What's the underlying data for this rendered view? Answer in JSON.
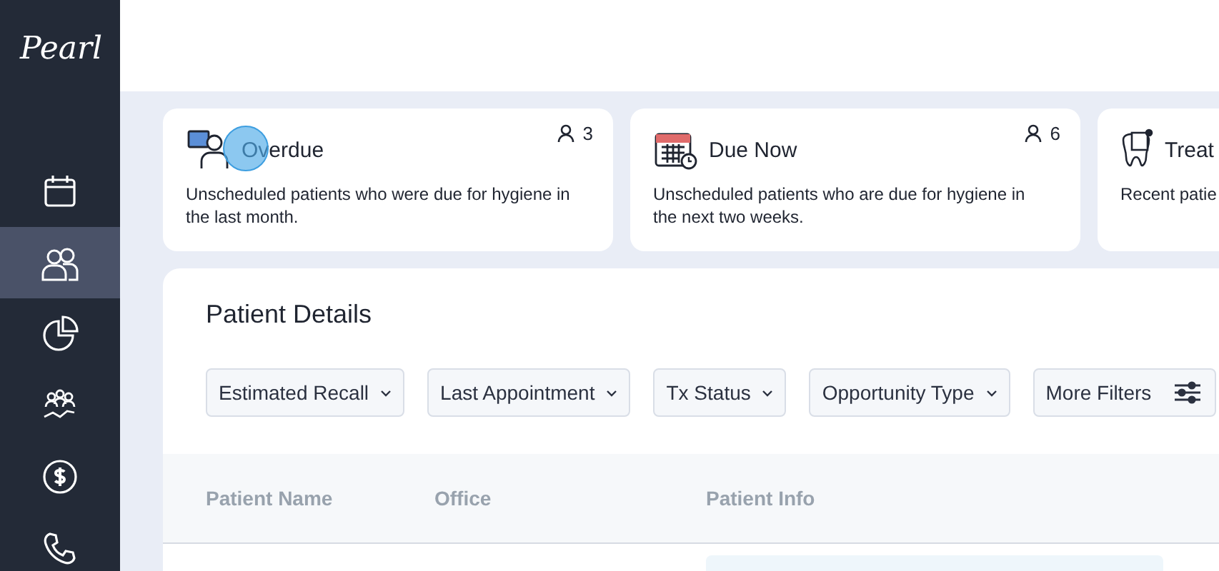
{
  "sidebar": {
    "logo": "Pearl",
    "items": [
      {
        "selected": false
      },
      {
        "selected": true
      },
      {
        "selected": false
      },
      {
        "selected": false
      },
      {
        "selected": false
      },
      {
        "selected": false
      }
    ]
  },
  "cards": [
    {
      "title": "Overdue",
      "count": "3",
      "description": "Unscheduled patients who were due for hygiene in the last month.",
      "highlighted": true
    },
    {
      "title": "Due Now",
      "count": "6",
      "description": "Unscheduled patients who are due for hygiene in the next two weeks.",
      "highlighted": false
    },
    {
      "title": "Treat",
      "description": "Recent patie",
      "highlighted": false
    }
  ],
  "details": {
    "title": "Patient Details",
    "filters": [
      {
        "label": "Estimated Recall",
        "kind": "dropdown"
      },
      {
        "label": "Last Appointment",
        "kind": "dropdown"
      },
      {
        "label": "Tx Status",
        "kind": "dropdown"
      },
      {
        "label": "Opportunity Type",
        "kind": "dropdown"
      },
      {
        "label": "More Filters",
        "kind": "sliders"
      }
    ],
    "columns": [
      "Patient Name",
      "Office",
      "Patient Info"
    ]
  }
}
